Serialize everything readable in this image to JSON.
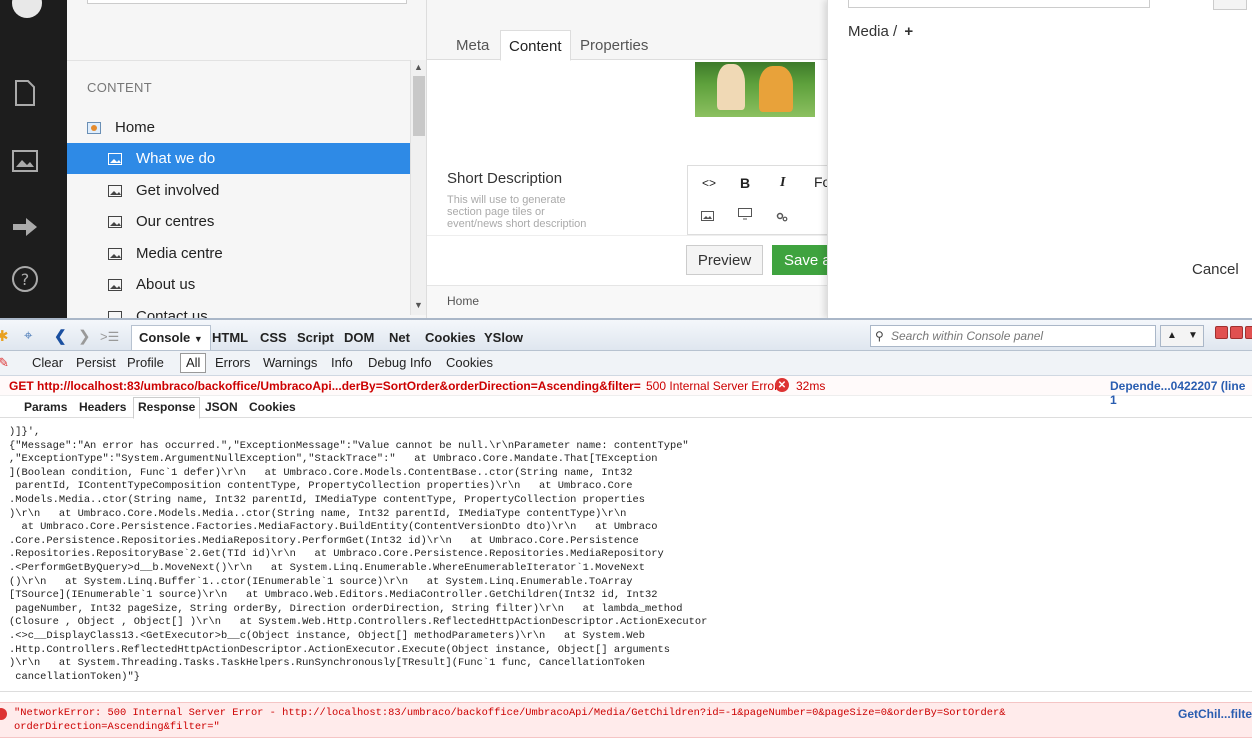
{
  "tree": {
    "section_title": "CONTENT",
    "items": [
      {
        "label": "Home"
      },
      {
        "label": "What we do"
      },
      {
        "label": "Get involved"
      },
      {
        "label": "Our centres"
      },
      {
        "label": "Media centre"
      },
      {
        "label": "About us"
      },
      {
        "label": "Contact us"
      }
    ]
  },
  "editor": {
    "tabs": [
      {
        "label": "Meta"
      },
      {
        "label": "Content"
      },
      {
        "label": "Properties"
      }
    ],
    "active_tab": "Content",
    "short_description_label": "Short Description",
    "short_description_help": "This will use to generate section page tiles or event/news short description",
    "rte": {
      "source": "<>",
      "bold": "B",
      "italic": "I",
      "format": "Fo"
    },
    "preview_label": "Preview",
    "save_label": "Save a",
    "breadcrumb": "Home"
  },
  "media_picker": {
    "breadcrumb": "Media /",
    "add_glyph": "+",
    "cancel_label": "Cancel"
  },
  "firebug": {
    "tabs": {
      "console": "Console",
      "html": "HTML",
      "css": "CSS",
      "script": "Script",
      "dom": "DOM",
      "net": "Net",
      "cookies": "Cookies",
      "yslow": "YSlow"
    },
    "search_placeholder": "Search within Console panel",
    "filters": {
      "clear": "Clear",
      "persist": "Persist",
      "profile": "Profile",
      "all": "All",
      "errors": "Errors",
      "warnings": "Warnings",
      "info": "Info",
      "debug": "Debug Info",
      "cookies": "Cookies"
    },
    "request": {
      "line": "GET http://localhost:83/umbraco/backoffice/UmbracoApi...derBy=SortOrder&orderDirection=Ascending&filter=",
      "status": "500 Internal Server Error",
      "time": "32ms",
      "source": "Depende...0422207 (line 1"
    },
    "response_tabs": {
      "params": "Params",
      "headers": "Headers",
      "response": "Response",
      "json": "JSON",
      "cookies": "Cookies"
    },
    "response_text": ")]}',\n{\"Message\":\"An error has occurred.\",\"ExceptionMessage\":\"Value cannot be null.\\r\\nParameter name: contentType\"\n,\"ExceptionType\":\"System.ArgumentNullException\",\"StackTrace\":\"   at Umbraco.Core.Mandate.That[TException\n](Boolean condition, Func`1 defer)\\r\\n   at Umbraco.Core.Models.ContentBase..ctor(String name, Int32\n parentId, IContentTypeComposition contentType, PropertyCollection properties)\\r\\n   at Umbraco.Core\n.Models.Media..ctor(String name, Int32 parentId, IMediaType contentType, PropertyCollection properties\n)\\r\\n   at Umbraco.Core.Models.Media..ctor(String name, Int32 parentId, IMediaType contentType)\\r\\n\n  at Umbraco.Core.Persistence.Factories.MediaFactory.BuildEntity(ContentVersionDto dto)\\r\\n   at Umbraco\n.Core.Persistence.Repositories.MediaRepository.PerformGet(Int32 id)\\r\\n   at Umbraco.Core.Persistence\n.Repositories.RepositoryBase`2.Get(TId id)\\r\\n   at Umbraco.Core.Persistence.Repositories.MediaRepository\n.<PerformGetByQuery>d__b.MoveNext()\\r\\n   at System.Linq.Enumerable.WhereEnumerableIterator`1.MoveNext\n()\\r\\n   at System.Linq.Buffer`1..ctor(IEnumerable`1 source)\\r\\n   at System.Linq.Enumerable.ToArray\n[TSource](IEnumerable`1 source)\\r\\n   at Umbraco.Web.Editors.MediaController.GetChildren(Int32 id, Int32\n pageNumber, Int32 pageSize, String orderBy, Direction orderDirection, String filter)\\r\\n   at lambda_method\n(Closure , Object , Object[] )\\r\\n   at System.Web.Http.Controllers.ReflectedHttpActionDescriptor.ActionExecutor\n.<>c__DisplayClass13.<GetExecutor>b__c(Object instance, Object[] methodParameters)\\r\\n   at System.Web\n.Http.Controllers.ReflectedHttpActionDescriptor.ActionExecutor.Execute(Object instance, Object[] arguments\n)\\r\\n   at System.Threading.Tasks.TaskHelpers.RunSynchronously[TResult](Func`1 func, CancellationToken\n cancellationToken)\"}",
    "network_error": "\"NetworkError: 500 Internal Server Error - http://localhost:83/umbraco/backoffice/UmbracoApi/Media/GetChildren?id=-1&pageNumber=0&pageSize=0&orderBy=SortOrder&\norderDirection=Ascending&filter=\"",
    "network_error_source": "GetChil...filte"
  },
  "colors": {
    "selected": "#2e8ae6",
    "save": "#3fa33f",
    "error": "#cc0000"
  }
}
